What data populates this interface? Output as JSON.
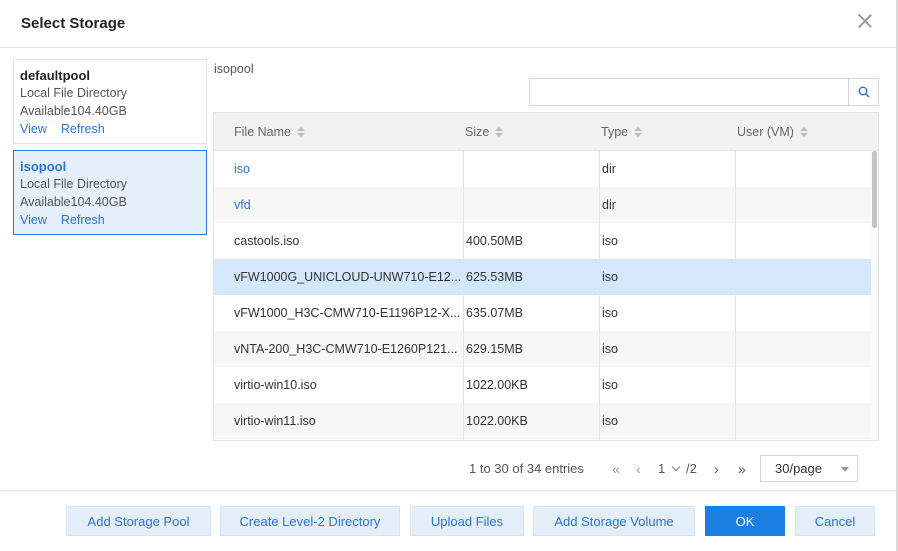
{
  "dialog": {
    "title": "Select Storage"
  },
  "pools": [
    {
      "name": "defaultpool",
      "type": "Local File Directory",
      "available": "Available104.40GB",
      "view": "View",
      "refresh": "Refresh",
      "selected": false
    },
    {
      "name": "isopool",
      "type": "Local File Directory",
      "available": "Available104.40GB",
      "view": "View",
      "refresh": "Refresh",
      "selected": true
    }
  ],
  "current_pool": "isopool",
  "search": {
    "value": "",
    "placeholder": ""
  },
  "table": {
    "columns": [
      "File Name",
      "Size",
      "Type",
      "User (VM)"
    ],
    "rows": [
      {
        "name": "iso",
        "size": "",
        "type": "dir",
        "user": "",
        "is_link": true
      },
      {
        "name": "vfd",
        "size": "",
        "type": "dir",
        "user": "",
        "is_link": true
      },
      {
        "name": "castools.iso",
        "size": "400.50MB",
        "type": "iso",
        "user": ""
      },
      {
        "name": "vFW1000G_UNICLOUD-UNW710-E12...",
        "size": "625.53MB",
        "type": "iso",
        "user": "",
        "selected": true
      },
      {
        "name": "vFW1000_H3C-CMW710-E1196P12-X...",
        "size": "635.07MB",
        "type": "iso",
        "user": ""
      },
      {
        "name": "vNTA-200_H3C-CMW710-E1260P121...",
        "size": "629.15MB",
        "type": "iso",
        "user": ""
      },
      {
        "name": "virtio-win10.iso",
        "size": "1022.00KB",
        "type": "iso",
        "user": ""
      },
      {
        "name": "virtio-win11.iso",
        "size": "1022.00KB",
        "type": "iso",
        "user": ""
      }
    ]
  },
  "pagination": {
    "summary": "1 to 30 of 34 entries",
    "first": "«",
    "prev": "‹",
    "current_page": "1",
    "total_pages": "/2",
    "next": "›",
    "last": "»",
    "page_size": "30/page"
  },
  "buttons": {
    "add_pool": "Add Storage Pool",
    "create_dir": "Create Level-2 Directory",
    "upload": "Upload Files",
    "add_volume": "Add Storage Volume",
    "ok": "OK",
    "cancel": "Cancel"
  },
  "colors": {
    "accent": "#1a7fe0",
    "link": "#2c74d6",
    "selected_row": "#d4e8fb"
  }
}
